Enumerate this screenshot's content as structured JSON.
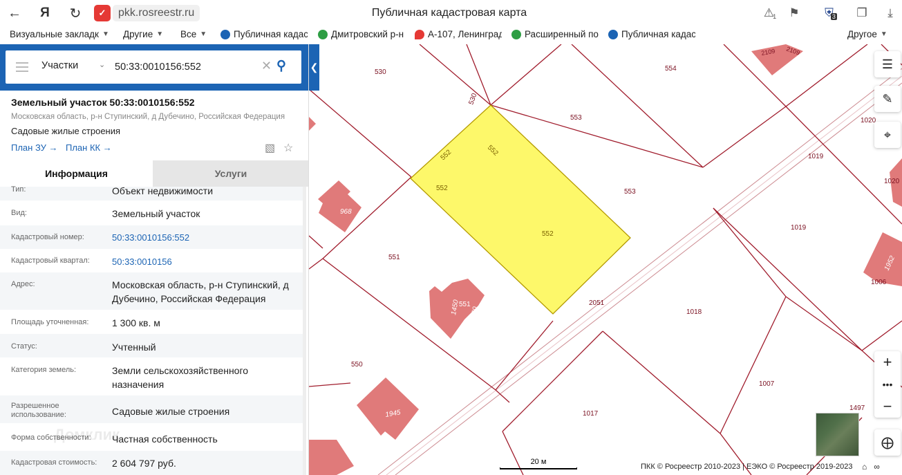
{
  "browser": {
    "site_badge": "✓",
    "url": "pkk.rosreestr.ru",
    "title": "Публичная кадастровая карта",
    "notif_count": "1",
    "ext_count": "3",
    "bookmarks": [
      {
        "label": "Визуальные закладк",
        "has_chevron": true
      },
      {
        "label": "Другие",
        "has_chevron": true
      },
      {
        "label": "Все",
        "has_chevron": true
      },
      {
        "label": "Публичная кадаст",
        "icon_color": "#1c64b4"
      },
      {
        "label": "Дмитровский р-н",
        "icon_color": "#2e9e44"
      },
      {
        "label": "А-107, Ленинград",
        "icon_color": "#e53935"
      },
      {
        "label": "Расширенный пои",
        "icon_color": "#2e9e44"
      },
      {
        "label": "Публичная кадаст",
        "icon_color": "#1c64b4"
      },
      {
        "label": "Другое",
        "has_chevron": true
      }
    ]
  },
  "search": {
    "type_label": "Участки",
    "query": "50:33:0010156:552"
  },
  "parcel": {
    "title": "Земельный участок 50:33:0010156:552",
    "address_line": "Московская область, р-н Ступинский, д Дубечино, Российская Федерация",
    "use": "Садовые жилые строения",
    "plan_zu": "План ЗУ →",
    "plan_kk": "План КК →"
  },
  "tabs": {
    "info": "Информация",
    "services": "Услуги"
  },
  "info_rows": [
    {
      "key": "Тип:",
      "value": "Объект недвижимости"
    },
    {
      "key": "Вид:",
      "value": "Земельный участок"
    },
    {
      "key": "Кадастровый номер:",
      "value": "50:33:0010156:552",
      "link": true
    },
    {
      "key": "Кадастровый квартал:",
      "value": "50:33:0010156",
      "link": true
    },
    {
      "key": "Адрес:",
      "value": "Московская область, р-н Ступинский, д Дубечино, Российская Федерация"
    },
    {
      "key": "Площадь уточненная:",
      "value": "1 300 кв. м"
    },
    {
      "key": "Статус:",
      "value": "Учтенный"
    },
    {
      "key": "Категория земель:",
      "value": "Земли сельскохозяйственного назначения"
    },
    {
      "key": "Разрешенное использование:",
      "value": "Садовые жилые строения"
    },
    {
      "key": "Форма собственности:",
      "value": "Частная собственность"
    },
    {
      "key": "Кадастровая стоимость:",
      "value": "2 604 797 руб."
    }
  ],
  "watermark": "Домклик",
  "map": {
    "colors": {
      "boundary": "#a01c2c",
      "selected_fill": "#fdf86a",
      "selected_stroke": "#b49a00",
      "building": "#e07a7a",
      "road": "#cc8a90"
    },
    "labels": [
      "530",
      "530",
      "554",
      "2109",
      "2109",
      "553",
      "553",
      "552",
      "552",
      "552",
      "552",
      "1020",
      "1020",
      "1019",
      "1019",
      "968",
      "551",
      "551",
      "1450",
      "1450",
      "450",
      "2051",
      "1018",
      "1952",
      "1006",
      "550",
      "1945",
      "1007",
      "1017",
      "1497"
    ],
    "scale_label": "20 м",
    "copyright": "ПКК © Росреестр 2010-2023 | ЕЭКО © Росреестр 2019-2023"
  }
}
